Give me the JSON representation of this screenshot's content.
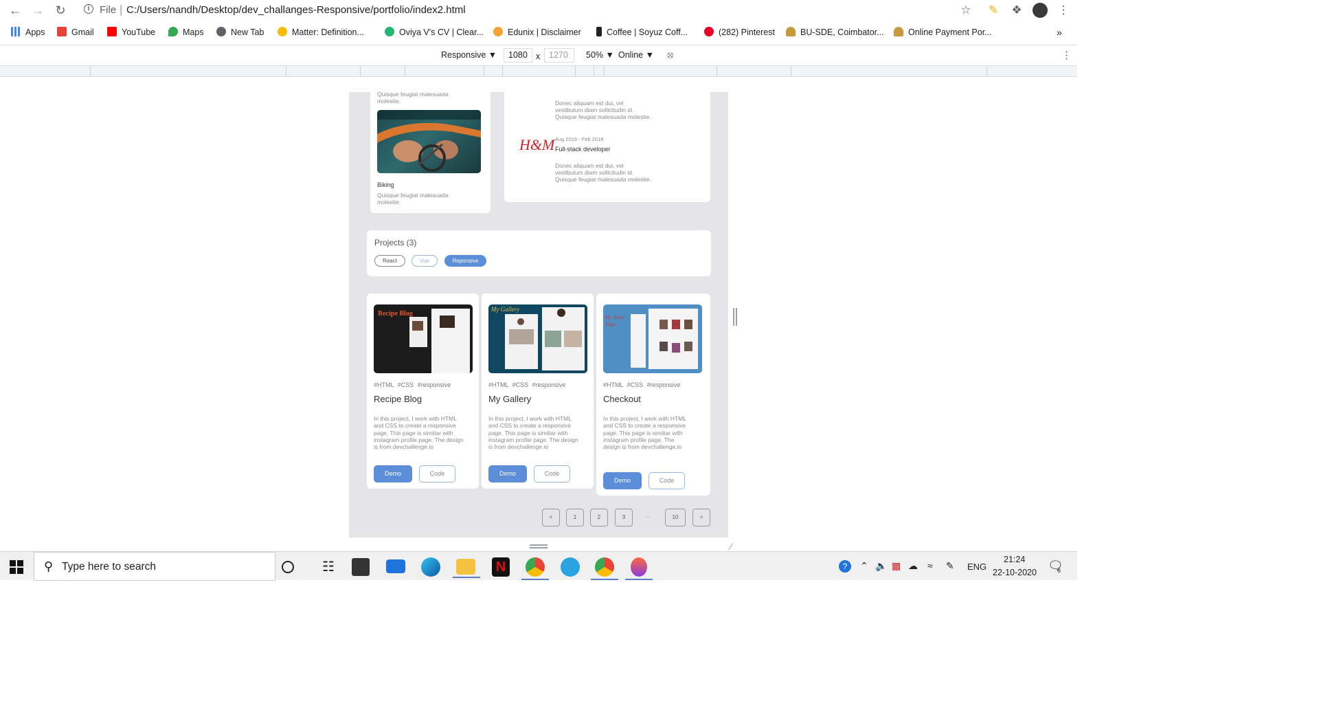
{
  "browser": {
    "url_scheme": "File",
    "url_path": "C:/Users/nandh/Desktop/dev_challanges-Responsive/portfolio/index2.html"
  },
  "bookmarks": [
    {
      "label": "Apps",
      "color": "#4285f4"
    },
    {
      "label": "Gmail",
      "color": "#ea4335"
    },
    {
      "label": "YouTube",
      "color": "#ff0000"
    },
    {
      "label": "Maps",
      "color": "#34a853"
    },
    {
      "label": "New Tab",
      "color": "#5f6368"
    },
    {
      "label": "Matter: Definition...",
      "color": "#fbbc04"
    },
    {
      "label": "Oviya V's CV | Clear...",
      "color": "#22b573"
    },
    {
      "label": "Edunix | Disclaimer",
      "color": "#f4a534"
    },
    {
      "label": "Coffee | Soyuz Coff...",
      "color": "#222222"
    },
    {
      "label": "(282) Pinterest",
      "color": "#e60023"
    },
    {
      "label": "BU-SDE, Coimbator...",
      "color": "#c79a3b"
    },
    {
      "label": "Online Payment Por...",
      "color": "#c79a3b"
    }
  ],
  "devtools": {
    "device": "Responsive ▼",
    "width": "1080",
    "times": "x",
    "height": "1270",
    "zoom": "50% ▼",
    "network": "Online ▼"
  },
  "hobbies": {
    "top_text": "Quisque feugiat malesuada molestie.",
    "item_title": "Biking",
    "item_text": "Quisque feugiat malesuada molestie."
  },
  "experience": {
    "desc1": "Donec aliquam est dui, vel vestibulum diam sollicitudin id. Quisque feugiat malesuada molestie.",
    "company_logo": "H&M",
    "dates": "Aug 2016 - Feb 2018",
    "role": "Full-stack developer",
    "desc2": "Donec aliquam est dui, vel vestibulum diam sollicitudin id. Quisque feugiat malesuada molestie."
  },
  "projects_header": {
    "title": "Projects (3)",
    "filters": [
      "React",
      "Vue",
      "Reponsive"
    ]
  },
  "projects": [
    {
      "tags": "#HTML #CSS #responsive",
      "title": "Recipe Blog",
      "desc": "In this project, I work with HTML and CSS to create a responsive page. This page is similiar with instagram profile page. The design is from devchallenge.io",
      "demo": "Demo",
      "code": "Code",
      "thumb_label": "Recipe Blog"
    },
    {
      "tags": "#HTML #CSS #responsive",
      "title": "My Gallery",
      "desc": "In this project, I work with HTML and CSS to create a responsive page. This page is similiar with instagram profile page. The design is from devchallenge.io",
      "demo": "Demo",
      "code": "Code",
      "thumb_label": "My Gallery"
    },
    {
      "tags": "#HTML #CSS #responsive",
      "title": "Checkout",
      "desc": "In this project, I work with HTML and CSS to create a responsive page. This page is similiar with instagram profile page. The design is from devchallenge.io",
      "demo": "Demo",
      "code": "Code",
      "thumb_label": "My Team Page"
    }
  ],
  "pagination": {
    "prev": "<",
    "pages": [
      "1",
      "2",
      "3"
    ],
    "ellipsis": "...",
    "last": "10",
    "next": ">"
  },
  "taskbar": {
    "search_placeholder": "Type here to search",
    "language": "ENG",
    "time": "21:24",
    "date": "22-10-2020",
    "notifications": "6"
  },
  "colors": {
    "accent": "#5b8dd9",
    "page_bg": "#e5e5e7"
  }
}
